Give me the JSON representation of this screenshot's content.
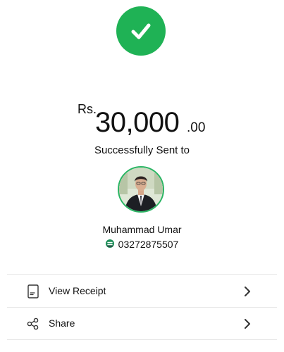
{
  "transaction": {
    "currency": "Rs.",
    "amount_main": "30,000",
    "amount_decimal": ".00",
    "status_text": "Successfully Sent to"
  },
  "recipient": {
    "name": "Muhammad Umar",
    "phone": "03272875507"
  },
  "actions": [
    {
      "label": "View Receipt",
      "icon": "receipt-icon"
    },
    {
      "label": "Share",
      "icon": "share-icon"
    }
  ],
  "colors": {
    "success": "#1fb255",
    "avatar_ring": "#2bb564",
    "divider": "#e6e6e6",
    "text": "#111111"
  }
}
